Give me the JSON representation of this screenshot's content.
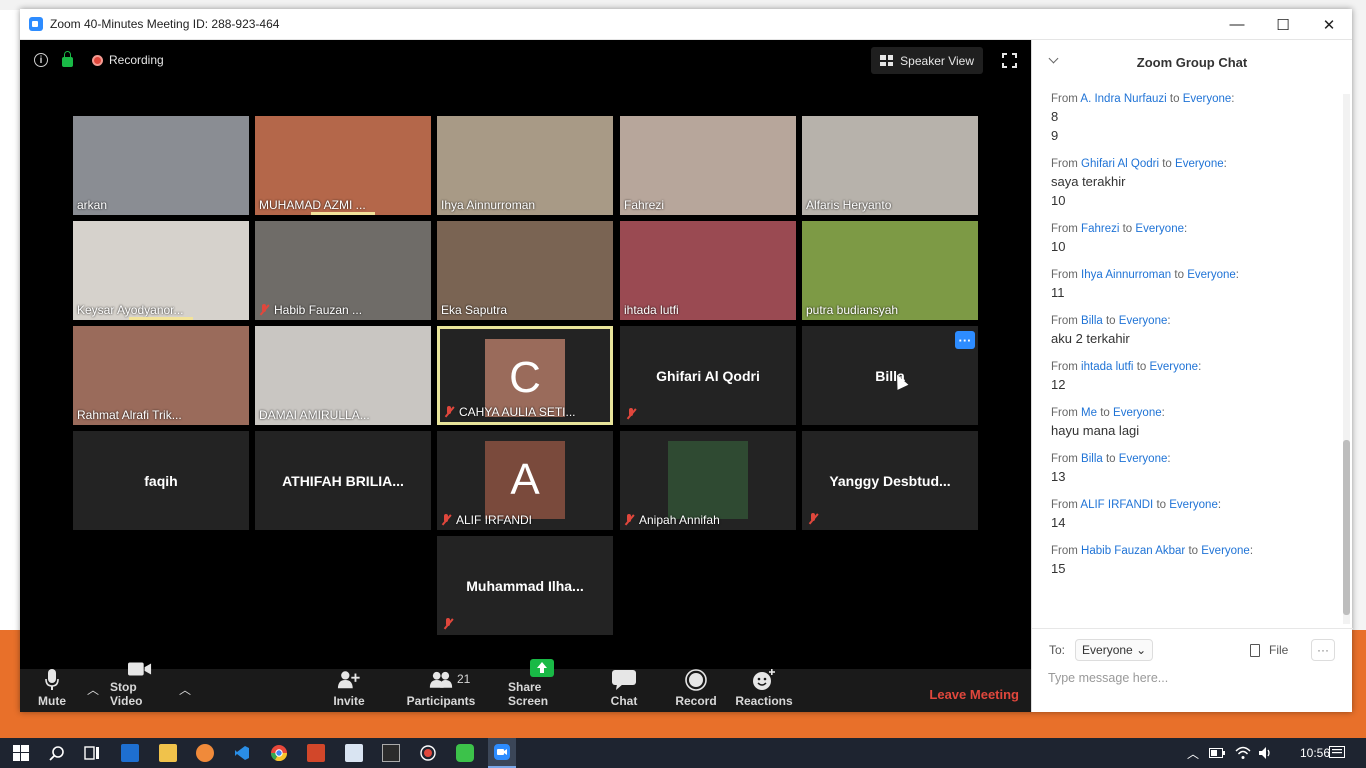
{
  "window": {
    "title": "Zoom 40-Minutes Meeting ID: 288-923-464"
  },
  "window_controls": {
    "minimize": "—",
    "maximize": "☐",
    "close": "✕"
  },
  "meeting_bar": {
    "recording_label": "Recording",
    "speaker_view_label": "Speaker View"
  },
  "tiles": [
    {
      "name": "arkan",
      "kind": "video",
      "bg": "#8a8d93"
    },
    {
      "name": "MUHAMAD AZMI ...",
      "kind": "video",
      "bg": "#b4674a",
      "speaking": true
    },
    {
      "name": "Ihya Ainnurroman",
      "kind": "video",
      "bg": "#a89a86"
    },
    {
      "name": "Fahrezi",
      "kind": "video",
      "bg": "#b7a69b"
    },
    {
      "name": "Alfaris Heryanto",
      "kind": "video",
      "bg": "#b7b2ab"
    },
    {
      "name": "Keysar Ayodyanor...",
      "kind": "video",
      "bg": "#d6d2cc",
      "speaking": true
    },
    {
      "name": "Habib Fauzan ...",
      "kind": "video",
      "bg": "#6f6c68",
      "muted": true
    },
    {
      "name": "Eka Saputra",
      "kind": "video",
      "bg": "#7a6453"
    },
    {
      "name": "ihtada lutfi",
      "kind": "video",
      "bg": "#9a4a52"
    },
    {
      "name": "putra budiansyah",
      "kind": "video",
      "bg": "#7d9a45"
    },
    {
      "name": "Rahmat Alrafi Trik...",
      "kind": "video",
      "bg": "#9a6b5b"
    },
    {
      "name": "DAMAI AMIRULLA...",
      "kind": "video",
      "bg": "#c9c6c2"
    },
    {
      "name": "CAHYA AULIA SETI...",
      "kind": "avatar",
      "avatar_letter": "C",
      "avatar_color": "#9a6b5b",
      "muted": true,
      "active": true
    },
    {
      "name": "Ghifari Al Qodri",
      "kind": "name",
      "muted": true
    },
    {
      "name": "Billa",
      "kind": "name",
      "more": true
    },
    {
      "name": "faqih",
      "kind": "name"
    },
    {
      "name": "ATHIFAH BRILIA...",
      "kind": "name"
    },
    {
      "name": "ALIF IRFANDI",
      "kind": "avatar",
      "avatar_letter": "A",
      "avatar_color": "#7a4a3c",
      "muted": true
    },
    {
      "name": "Anipah Annifah",
      "kind": "photo",
      "avatar_color": "#2f4a32",
      "muted": true
    },
    {
      "name": "Yanggy  Desbtud...",
      "kind": "name",
      "muted": true
    },
    {
      "name": "Muhammad  Ilha...",
      "kind": "name",
      "muted": true
    }
  ],
  "toolbar": {
    "mute": "Mute",
    "stop_video": "Stop Video",
    "invite": "Invite",
    "participants": "Participants",
    "participants_count": "21",
    "share_screen": "Share Screen",
    "chat": "Chat",
    "record": "Record",
    "reactions": "Reactions",
    "leave": "Leave Meeting"
  },
  "chat": {
    "title": "Zoom Group Chat",
    "messages": [
      {
        "from": "A. Indra Nurfauzi",
        "to": "Everyone",
        "lines": [
          "8",
          "9"
        ]
      },
      {
        "from": "Ghifari Al Qodri",
        "to": "Everyone",
        "lines": [
          "saya terakhir",
          "10"
        ]
      },
      {
        "from": "Fahrezi",
        "to": "Everyone",
        "lines": [
          "10"
        ]
      },
      {
        "from": "Ihya Ainnurroman",
        "to": "Everyone",
        "lines": [
          "11"
        ]
      },
      {
        "from": "Billa",
        "to": "Everyone",
        "lines": [
          "aku 2 terkahir"
        ]
      },
      {
        "from": "ihtada lutfi",
        "to": "Everyone",
        "lines": [
          "12"
        ]
      },
      {
        "from": "Me",
        "to": "Everyone",
        "lines": [
          "hayu mana lagi"
        ]
      },
      {
        "from": "Billa",
        "to": "Everyone",
        "lines": [
          "13"
        ]
      },
      {
        "from": "ALIF IRFANDI",
        "to": "Everyone",
        "lines": [
          "14"
        ]
      },
      {
        "from": "Habib Fauzan Akbar",
        "to": "Everyone",
        "lines": [
          "15"
        ]
      }
    ],
    "from_prefix": "From",
    "to_word": "to",
    "to_label": "To:",
    "to_value": "Everyone",
    "file_label": "File",
    "more_label": "···",
    "input_placeholder": "Type message here..."
  },
  "taskbar": {
    "time": "10:56"
  }
}
